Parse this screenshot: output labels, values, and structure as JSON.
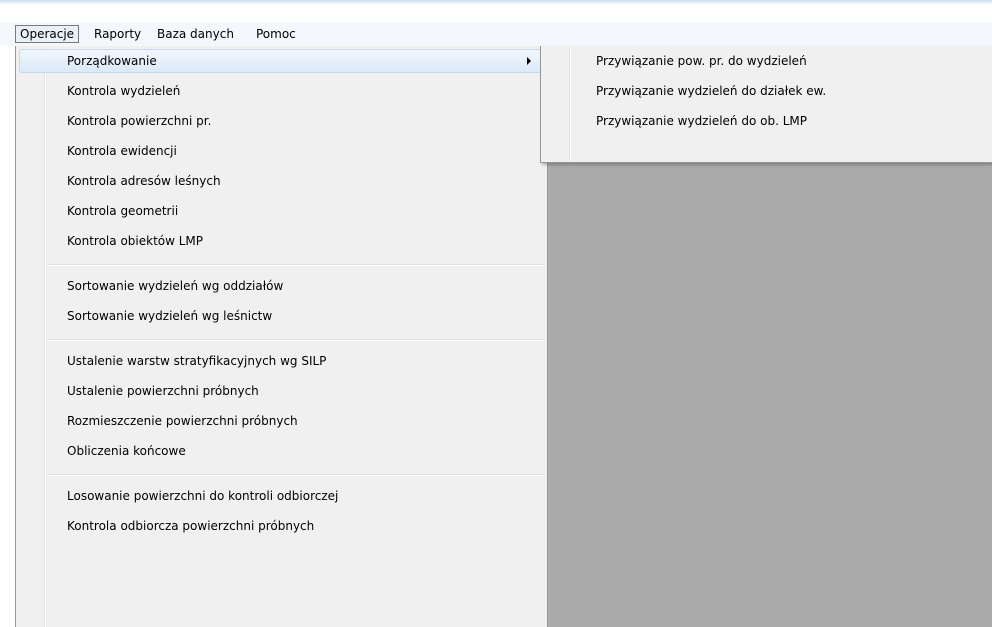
{
  "menubar": {
    "items": [
      {
        "label": "Operacje",
        "open": true
      },
      {
        "label": "Raporty"
      },
      {
        "label": "Baza danych"
      },
      {
        "label": "Pomoc"
      }
    ]
  },
  "operacje_menu": {
    "groups": [
      [
        "Porządkowanie",
        "Kontrola wydzieleń",
        "Kontrola powierzchni pr.",
        "Kontrola ewidencji",
        "Kontrola adresów leśnych",
        "Kontrola geometrii",
        "Kontrola obiektów LMP"
      ],
      [
        "Sortowanie wydzieleń wg oddziałów",
        "Sortowanie wydzieleń wg leśnictw"
      ],
      [
        "Ustalenie warstw stratyfikacyjnych wg SILP",
        "Ustalenie powierzchni próbnych",
        "Rozmieszczenie powierzchni próbnych",
        "Obliczenia końcowe"
      ],
      [
        "Losowanie powierzchni do kontroli odbiorczej",
        "Kontrola odbiorcza powierzchni próbnych"
      ]
    ]
  },
  "porzadkowanie_submenu": {
    "items": [
      "Przywiązanie pow. pr. do wydzieleń",
      "Przywiązanie wydzieleń do działek ew.",
      "Przywiązanie wydzieleń do ob. LMP"
    ]
  },
  "colors": {
    "menu_background": "#f0f0f0",
    "workspace_background": "#ababab",
    "highlight": "#dce9f8"
  }
}
